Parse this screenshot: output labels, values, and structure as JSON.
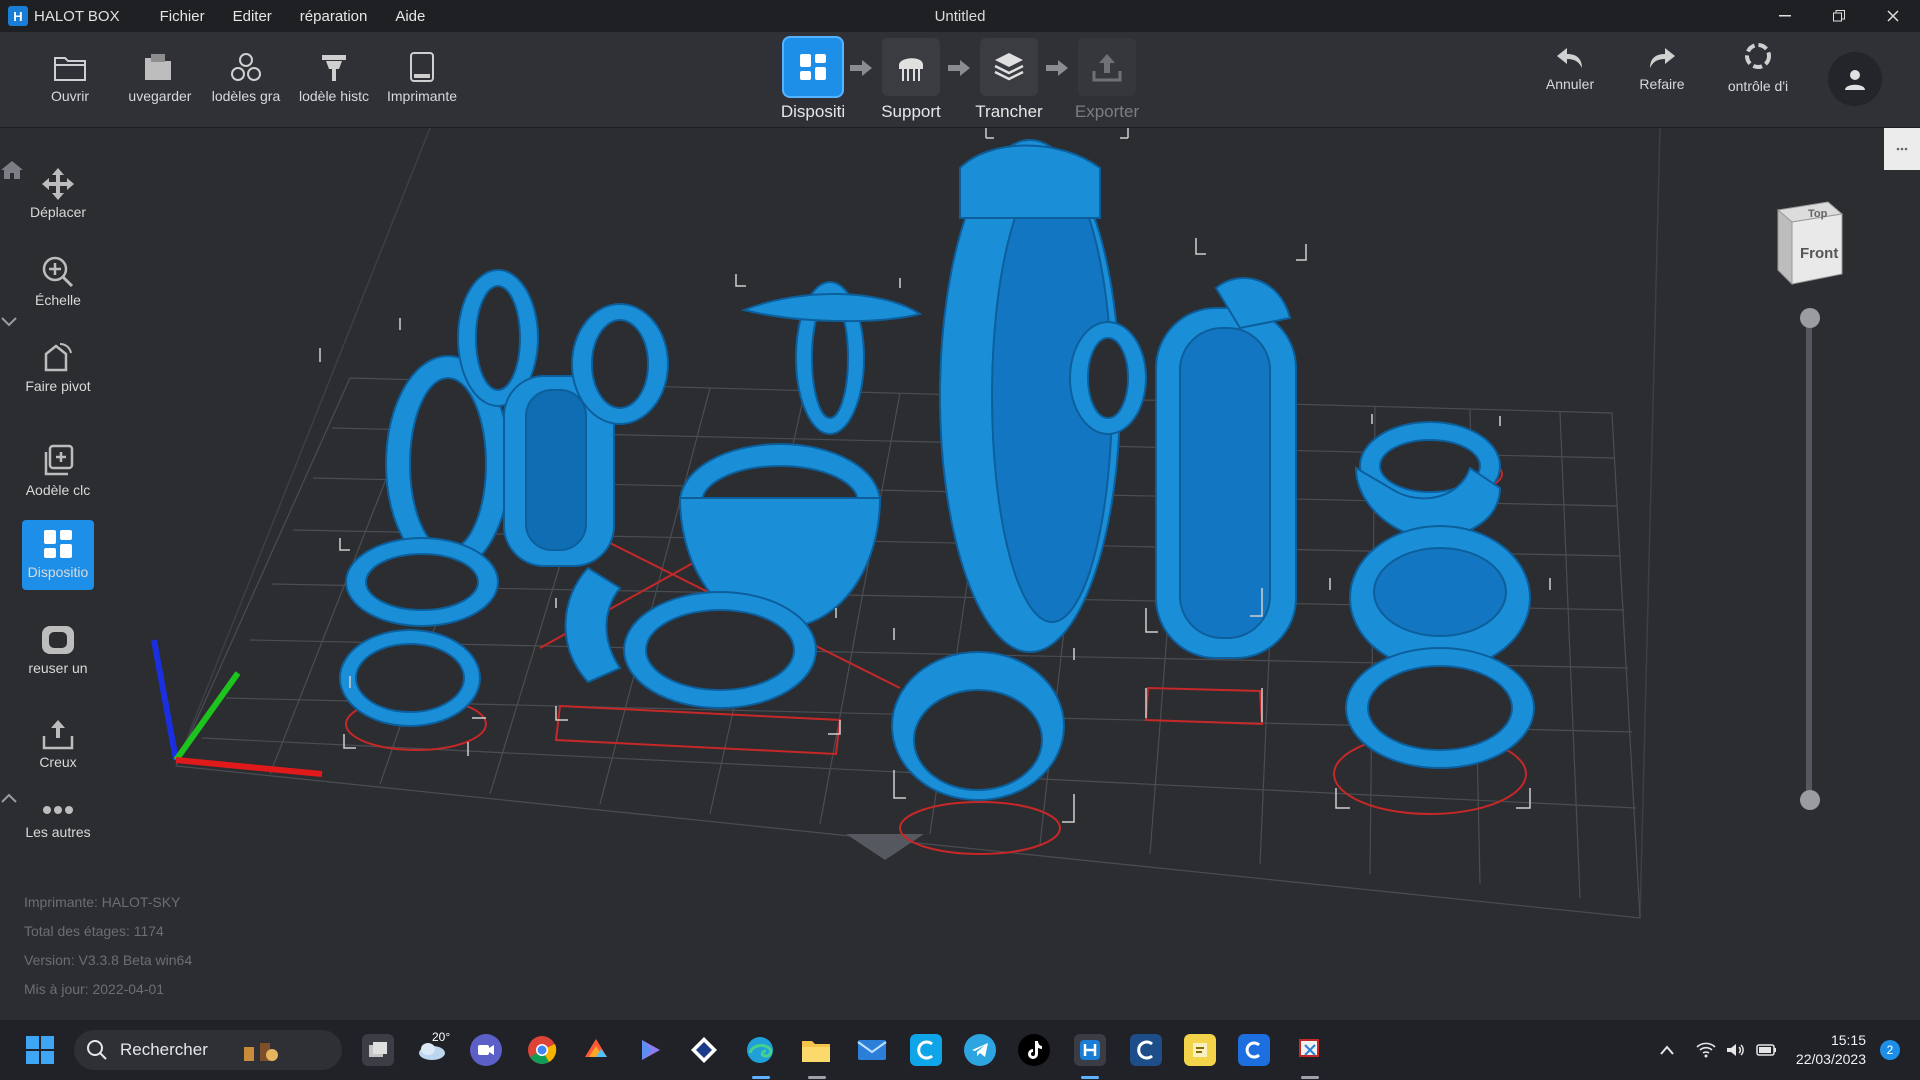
{
  "app": {
    "name": "HALOT BOX",
    "logo_letter": "H",
    "window_title": "Untitled",
    "menu": [
      "Fichier",
      "Editer",
      "réparation",
      "Aide"
    ]
  },
  "toolbar": {
    "left": [
      {
        "label": "Ouvrir",
        "icon": "folder-open-icon"
      },
      {
        "label": " uvegarder",
        "icon": "save-icon"
      },
      {
        "label": "lodèles gra",
        "icon": "models-library-icon"
      },
      {
        "label": "lodèle histc",
        "icon": "model-history-icon"
      },
      {
        "label": "Imprimante",
        "icon": "printer-icon"
      }
    ],
    "steps": [
      {
        "label": "Dispositi",
        "state": "active",
        "icon": "layout-icon"
      },
      {
        "label": "Support",
        "state": "normal",
        "icon": "support-icon"
      },
      {
        "label": "Trancher",
        "state": "normal",
        "icon": "slice-layers-icon"
      },
      {
        "label": "Exporter",
        "state": "disabled",
        "icon": "export-icon"
      }
    ],
    "right": [
      {
        "label": "Annuler",
        "icon": "undo-icon"
      },
      {
        "label": "Refaire",
        "icon": "redo-icon"
      },
      {
        "label": "ontrôle d'i",
        "icon": "control-icon"
      }
    ]
  },
  "sidebar": [
    {
      "label": "Déplacer",
      "icon": "move-icon",
      "active": false
    },
    {
      "label": "Échelle",
      "icon": "scale-icon",
      "active": false
    },
    {
      "label": "Faire pivot",
      "icon": "rotate-icon",
      "active": false
    },
    {
      "label": "Aodèle clc",
      "icon": "clone-icon",
      "active": false
    },
    {
      "label": "Dispositio",
      "icon": "layout-icon",
      "active": true
    },
    {
      "label": "reuser un",
      "icon": "hollow-icon",
      "active": false
    },
    {
      "label": "Creux",
      "icon": "drain-icon",
      "active": false
    },
    {
      "label": "Les autres",
      "icon": "more-icon",
      "active": false
    }
  ],
  "info": {
    "printer": "Imprimante: HALOT-SKY",
    "layers": "Total des étages: 1174",
    "version": "Version: V3.3.8 Beta win64",
    "updated": "Mis à jour:  2022-04-01"
  },
  "view_cube": {
    "top": "Top",
    "front": "Front"
  },
  "colors": {
    "accent": "#1e8fe8",
    "model": "#1a8fd8",
    "grid": "#4a4d52",
    "bbox": "#d23030"
  },
  "taskbar": {
    "search_placeholder": "Rechercher",
    "weather": "20°",
    "time": "15:15",
    "date": "22/03/2023",
    "notifications": "2",
    "apps": [
      "task-view-icon",
      "weather-icon",
      "teams-icon",
      "chrome-icon",
      "color-app-icon",
      "app-icon",
      "app-icon",
      "edge-icon",
      "file-explorer-icon",
      "mail-icon",
      "app-icon",
      "telegram-icon",
      "tiktok-icon",
      "halot-box-icon",
      "app-icon",
      "app-icon",
      "app-icon",
      "snipping-icon"
    ]
  }
}
